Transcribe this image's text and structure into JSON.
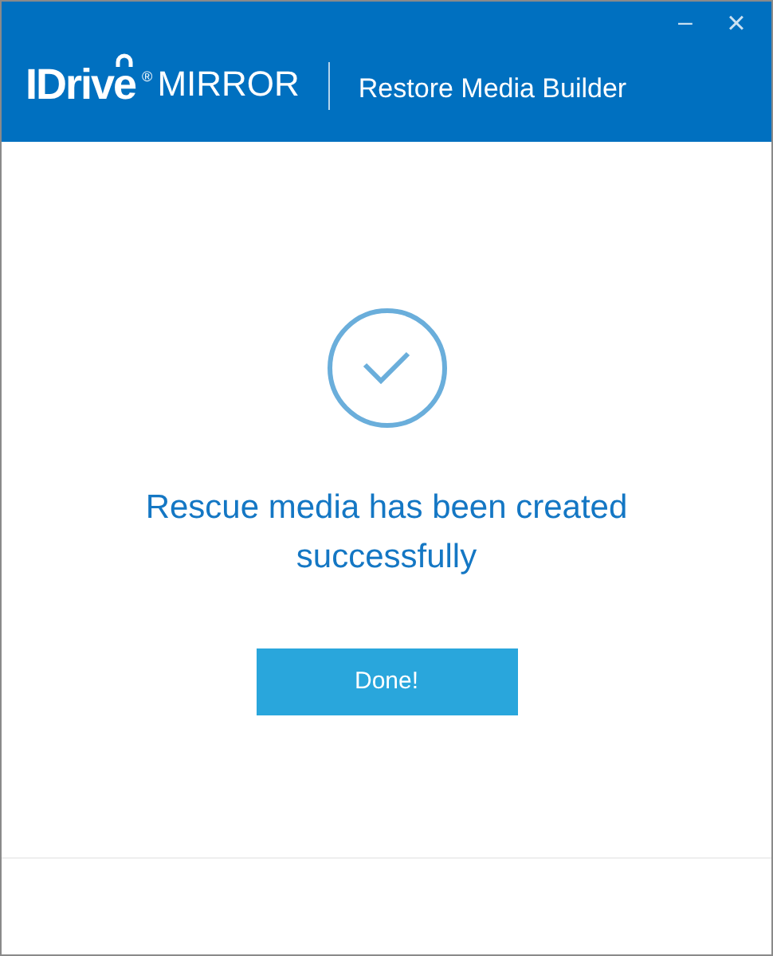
{
  "header": {
    "brand": "IDrive",
    "brand_mark": "®",
    "product": "MIRROR",
    "title": "Restore Media Builder"
  },
  "window_controls": {
    "minimize": "–",
    "close": "×"
  },
  "message": "Rescue media has been created successfully",
  "button": "Done!"
}
